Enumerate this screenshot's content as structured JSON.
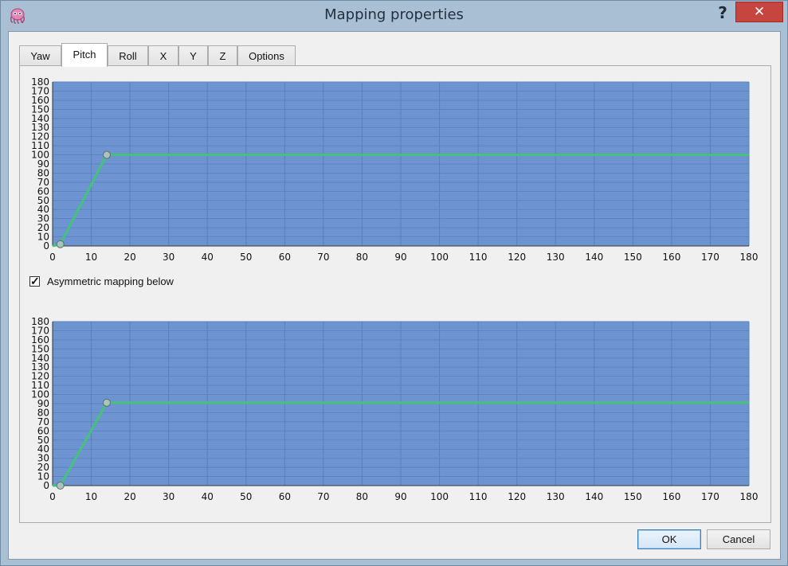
{
  "window": {
    "title": "Mapping properties",
    "help_label": "?",
    "close_label": "✕"
  },
  "tabs": [
    {
      "label": "Yaw",
      "active": false
    },
    {
      "label": "Pitch",
      "active": true
    },
    {
      "label": "Roll",
      "active": false
    },
    {
      "label": "X",
      "active": false
    },
    {
      "label": "Y",
      "active": false
    },
    {
      "label": "Z",
      "active": false
    },
    {
      "label": "Options",
      "active": false
    }
  ],
  "asymmetric": {
    "label": "Asymmetric mapping below",
    "checked": true,
    "check_glyph": "✓"
  },
  "buttons": {
    "ok": "OK",
    "cancel": "Cancel"
  },
  "colors": {
    "plot_bg": "#6f98d4",
    "grid_major": "#5a80bd",
    "grid_minor": "#6a8fcd",
    "curve": "#45c27a",
    "control_point": "#a8c4bc"
  },
  "chart_data": [
    {
      "type": "line",
      "series": [
        {
          "x": [
            0,
            2,
            14,
            180
          ],
          "y": [
            0,
            2,
            100,
            100
          ]
        }
      ],
      "control_points": [
        {
          "x": 2,
          "y": 2
        },
        {
          "x": 14,
          "y": 100
        }
      ],
      "xlim": [
        0,
        180
      ],
      "ylim": [
        0,
        180
      ],
      "xticks": [
        0,
        10,
        20,
        30,
        40,
        50,
        60,
        70,
        80,
        90,
        100,
        110,
        120,
        130,
        140,
        150,
        160,
        170,
        180
      ],
      "yticks": [
        0,
        10,
        20,
        30,
        40,
        50,
        60,
        70,
        80,
        90,
        100,
        110,
        120,
        130,
        140,
        150,
        160,
        170,
        180
      ],
      "grid": true
    },
    {
      "type": "line",
      "series": [
        {
          "x": [
            0,
            2,
            14,
            180
          ],
          "y": [
            0,
            0,
            91,
            91
          ]
        }
      ],
      "control_points": [
        {
          "x": 2,
          "y": 0
        },
        {
          "x": 14,
          "y": 91
        }
      ],
      "xlim": [
        0,
        180
      ],
      "ylim": [
        0,
        180
      ],
      "xticks": [
        0,
        10,
        20,
        30,
        40,
        50,
        60,
        70,
        80,
        90,
        100,
        110,
        120,
        130,
        140,
        150,
        160,
        170,
        180
      ],
      "yticks": [
        0,
        10,
        20,
        30,
        40,
        50,
        60,
        70,
        80,
        90,
        100,
        110,
        120,
        130,
        140,
        150,
        160,
        170,
        180
      ],
      "grid": true
    }
  ]
}
